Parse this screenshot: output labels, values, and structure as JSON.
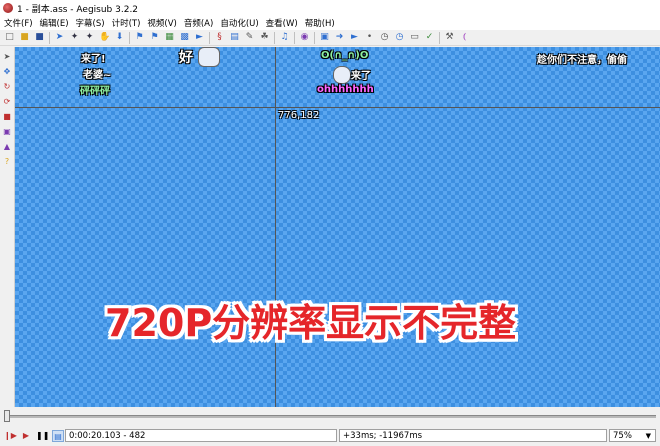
{
  "window": {
    "title": "1 - 副本.ass - Aegisub 3.2.2"
  },
  "menu": [
    "文件(F)",
    "编辑(E)",
    "字幕(S)",
    "计时(T)",
    "视频(V)",
    "音频(A)",
    "自动化(U)",
    "查看(W)",
    "帮助(H)"
  ],
  "toolbar_icons": [
    "new-file",
    "open-file",
    "save-file",
    "sep",
    "jump-arrow",
    "wand",
    "wand-2",
    "hand-tool",
    "sep",
    "flag-blue",
    "flag-blue-2",
    "properties",
    "styles",
    "attachments",
    "sep",
    "automation",
    "translate",
    "paint",
    "spellcheck",
    "sep",
    "karaoke",
    "sep",
    "video-detach",
    "play-arrow",
    "color",
    "dot",
    "timer",
    "clock",
    "fonts",
    "check",
    "sep",
    "hammer",
    "tags"
  ],
  "side_tools": [
    "drag-tool",
    "move-tool",
    "rotate-z",
    "rotate-xy",
    "scale",
    "clip-rect",
    "clip-vector",
    "help"
  ],
  "video": {
    "coord_readout": "776,182",
    "subtitles": [
      {
        "text": "来了!",
        "color": "#ffffff"
      },
      {
        "text": "老婆~",
        "color": "#ffffff"
      },
      {
        "text": "砰砰砰",
        "color": "#8ff0a0"
      },
      {
        "text": "好",
        "color": "#ffffff"
      },
      {
        "text": "O(∩_∩)O",
        "color": "#8ff0a0"
      },
      {
        "text": "来了",
        "color": "#ffffff"
      },
      {
        "text": "ohhhhhhh",
        "color": "#ff66ff"
      },
      {
        "text": "趁你们不注意，偷偷",
        "color": "#ffffff"
      }
    ],
    "caption": "720P分辨率显示不完整"
  },
  "status": {
    "time": "0:00:20.103 - 482",
    "offset": "+33ms; -11967ms",
    "zoom": "75%"
  }
}
